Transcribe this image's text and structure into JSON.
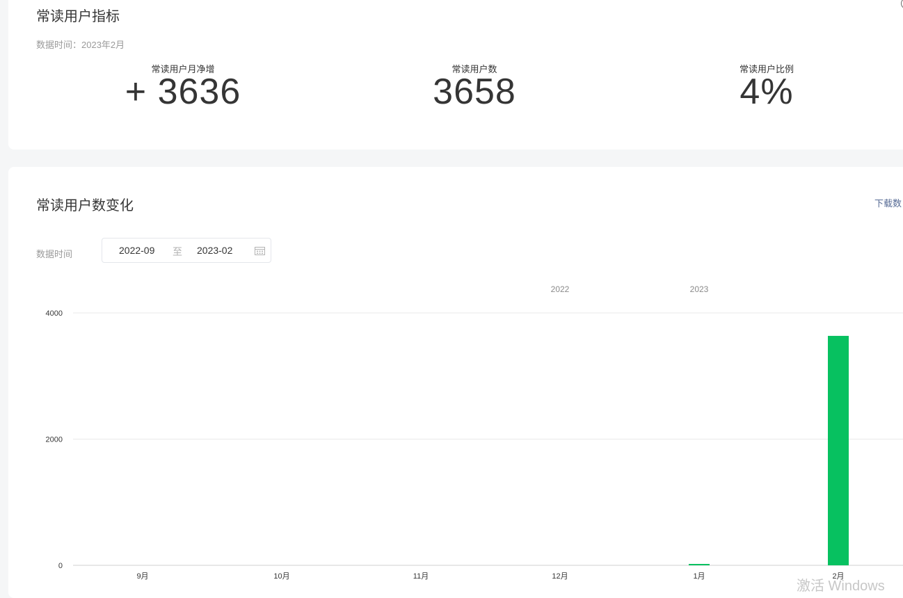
{
  "metrics_card": {
    "title": "常读用户指标",
    "data_time": "数据时间：2023年2月",
    "items": [
      {
        "label": "常读用户月净增",
        "value": "+ 3636"
      },
      {
        "label": "常读用户数",
        "value": "3658"
      },
      {
        "label": "常读用户比例",
        "value": "4%"
      }
    ]
  },
  "trend_card": {
    "title": "常读用户数变化",
    "download": "下载数",
    "filter_label": "数据时间",
    "range_start": "2022-09",
    "range_sep": "至",
    "range_end": "2023-02"
  },
  "colors": {
    "bar": "#07c160",
    "grid": "#e8e8e8",
    "axis_text": "#353535"
  },
  "chart_data": {
    "type": "bar",
    "categories": [
      "9月",
      "10月",
      "11月",
      "12月",
      "1月",
      "2月"
    ],
    "year_labels": [
      {
        "category": "12月",
        "label": "2022"
      },
      {
        "category": "1月",
        "label": "2023"
      }
    ],
    "values": [
      0,
      0,
      0,
      0,
      22,
      3636
    ],
    "yticks": [
      0,
      2000,
      4000
    ],
    "ylim": [
      0,
      4000
    ],
    "grid": true
  },
  "watermark": "激活 Windows"
}
